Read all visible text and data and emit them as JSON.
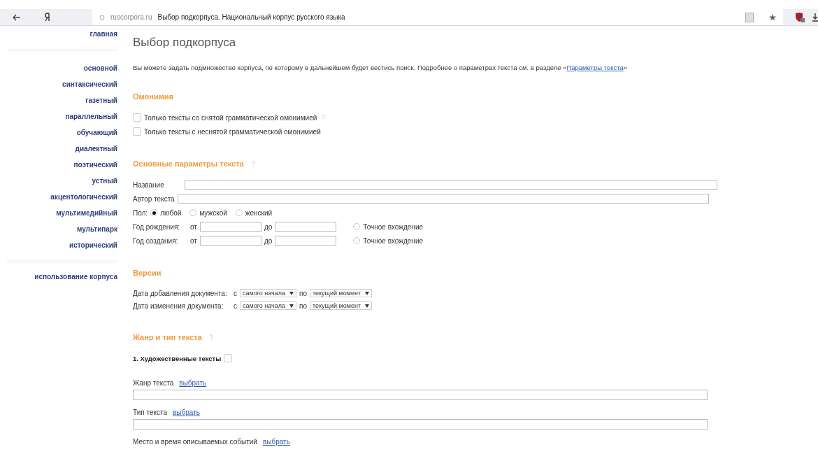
{
  "browser": {
    "domain": "ruscorpora.ru",
    "title": "Выбор подкорпуса. Национальный корпус русского языка"
  },
  "sidebar": {
    "home": "главная",
    "items": [
      "основной",
      "синтаксический",
      "газетный",
      "параллельный",
      "обучающий",
      "диалектный",
      "поэтический",
      "устный",
      "акцентологический",
      "мультимедийный",
      "мультипарк",
      "исторический"
    ],
    "usage": "использование корпуса"
  },
  "page_title": "Выбор подкорпуса",
  "intro": {
    "text": "Вы можете задать подмножество корпуса, по которому в дальнейшем будет вестись поиск. Подробнее о параметрах текста см. в разделе «",
    "link": "Параметры текста",
    "after": "»"
  },
  "homonymy": {
    "heading": "Омонимия",
    "options": [
      {
        "label": "Только тексты со снятой грамматической омонимией",
        "checked": false,
        "help": true
      },
      {
        "label": "Только тексты с неснятой грамматической омонимией",
        "checked": false,
        "help": false
      }
    ]
  },
  "basic": {
    "heading": "Основные параметры текста",
    "fields": [
      {
        "label": "Название"
      },
      {
        "label": "Автор текста"
      }
    ],
    "gender": {
      "label": "Пол:",
      "options": [
        {
          "label": "любой",
          "selected": true
        },
        {
          "label": "мужской",
          "selected": false
        },
        {
          "label": "женский",
          "selected": false
        }
      ]
    },
    "ranges": [
      {
        "label": "Год рождения:",
        "from": "от",
        "to": "до",
        "exact": "Точное вхождение",
        "checked": false
      },
      {
        "label": "Год создания:",
        "from": "от",
        "to": "до",
        "exact": "Точное вхождение",
        "checked": false
      }
    ]
  },
  "versions": {
    "heading": "Версии",
    "rows": [
      {
        "label": "Дата добавления документа:",
        "from": "с",
        "from_value": "самого начала",
        "to": "по",
        "to_value": "текущий момент"
      },
      {
        "label": "Дата изменения документа:",
        "from": "с",
        "from_value": "самого начала",
        "to": "по",
        "to_value": "текущий момент"
      }
    ]
  },
  "genre": {
    "heading": "Жанр и тип текста",
    "subsection": {
      "label": "1. Художественные тексты",
      "checked": false
    },
    "pickers": [
      {
        "label": "Жанр текста",
        "link": "выбрать",
        "field": true
      },
      {
        "label": "Тип текста",
        "link": "выбрать",
        "field": true
      },
      {
        "label": "Место и время описываемых событий",
        "link": "выбрать",
        "field": false
      }
    ]
  }
}
